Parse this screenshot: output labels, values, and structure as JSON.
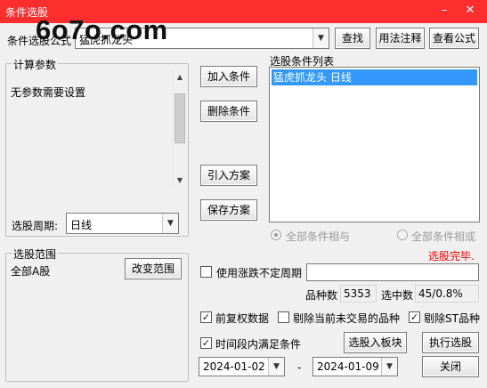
{
  "window": {
    "title": "条件选股",
    "minimize_glyph": "–",
    "close_glyph": "✕"
  },
  "watermark": "6o7o.com",
  "top_bar": {
    "formula_label": "条件选股公式",
    "formula_value": "猛虎抓龙头",
    "find_label": "查找",
    "usage_label": "用法注释",
    "view_formula_label": "查看公式"
  },
  "params": {
    "group_title": "计算参数",
    "message": "无参数需要设置",
    "period_label": "选股周期:",
    "period_value": "日线"
  },
  "actions": {
    "add_condition": "加入条件",
    "delete_condition": "删除条件",
    "import_scheme": "引入方案",
    "save_scheme": "保存方案"
  },
  "conditions": {
    "list_title": "选股条件列表",
    "items": [
      "猛虎抓龙头  日线"
    ],
    "all_and": "全部条件相与",
    "all_or": "全部条件相或",
    "status": "选股完毕.",
    "status_color": "#ff0000"
  },
  "scope": {
    "group_title": "选股范围",
    "value": "全部A股",
    "change_label": "改变范围"
  },
  "options": {
    "use_period": "使用涨跌不定周期",
    "variety_count_label": "品种数",
    "variety_count": "5353",
    "selected_label": "选中数",
    "selected_value": "45/0.8%",
    "forward_adjust": "前复权数据",
    "exclude_untraded": "剔除当前未交易的品种",
    "exclude_st": "剔除ST品种",
    "time_range": "时间段内满足条件",
    "into_block_label": "选股入板块",
    "execute_label": "执行选股",
    "date_from": "2024-01-02",
    "date_sep": "-",
    "date_to": "2024-01-09",
    "close_label": "关闭"
  }
}
